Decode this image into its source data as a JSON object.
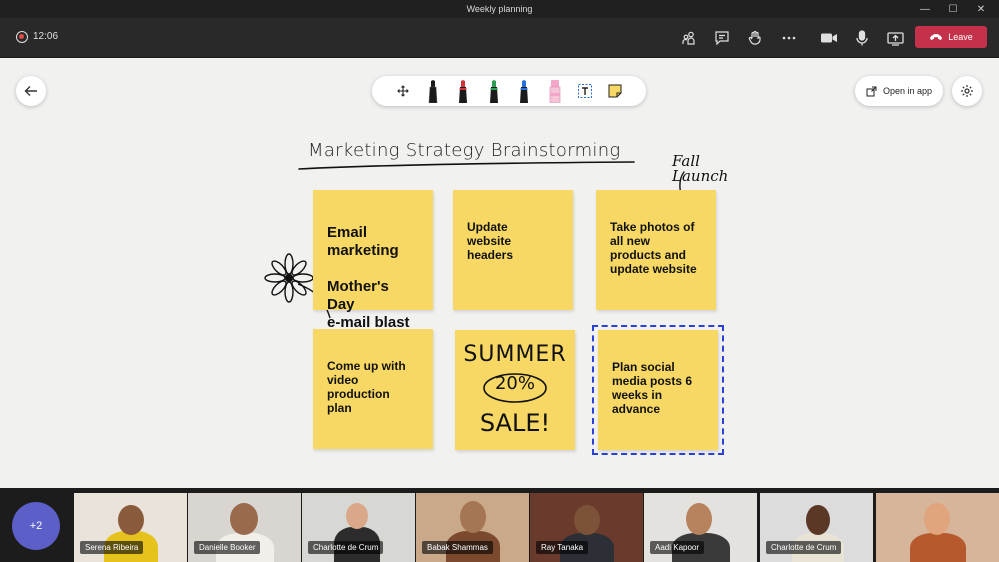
{
  "window": {
    "title": "Weekly planning"
  },
  "meeting": {
    "timer": "12:06",
    "leave_label": "Leave"
  },
  "canvas": {
    "open_in_app_label": "Open in app",
    "title": "Marketing Strategy Brainstorming",
    "annotation": "Fall\nLaunch",
    "notes": [
      {
        "text": "Email\nmarketing\n\nMother's Day\ne-mail blast"
      },
      {
        "text": "Update\nwebsite\nheaders"
      },
      {
        "text": "Take photos of\nall new\nproducts and\nupdate website"
      },
      {
        "text": "Come up with\nvideo\nproduction\nplan"
      },
      {
        "line1": "SUMMER",
        "line2": "20%",
        "line3": "SALE!"
      },
      {
        "text": "Plan social\nmedia posts 6\nweeks in\nadvance"
      }
    ]
  },
  "toolbar": {
    "tools": [
      "move-tool-icon",
      "black-pen-icon",
      "red-pen-icon",
      "green-pen-icon",
      "blue-pen-icon",
      "highlighter-icon",
      "text-tool-icon",
      "sticky-note-icon"
    ],
    "pen_colors": {
      "black": "#1b1b1b",
      "red": "#d13438",
      "green": "#2f9e57",
      "blue": "#2a6fd8",
      "highlighter": "#f3a6c8"
    }
  },
  "participants": {
    "overflow_label": "+2",
    "people": [
      {
        "name": "Serena Ribeira"
      },
      {
        "name": "Danielle Booker"
      },
      {
        "name": "Charlotte de Crum"
      },
      {
        "name": "Babak Shammas"
      },
      {
        "name": "Ray Tanaka"
      },
      {
        "name": "Aadi Kapoor"
      },
      {
        "name": "Charlotte de Crum"
      },
      {
        "name": ""
      }
    ]
  },
  "colors": {
    "accent": "#5b5fc7",
    "leave": "#c4314b",
    "sticky": "#f7d864",
    "selection": "#2a41d8"
  }
}
